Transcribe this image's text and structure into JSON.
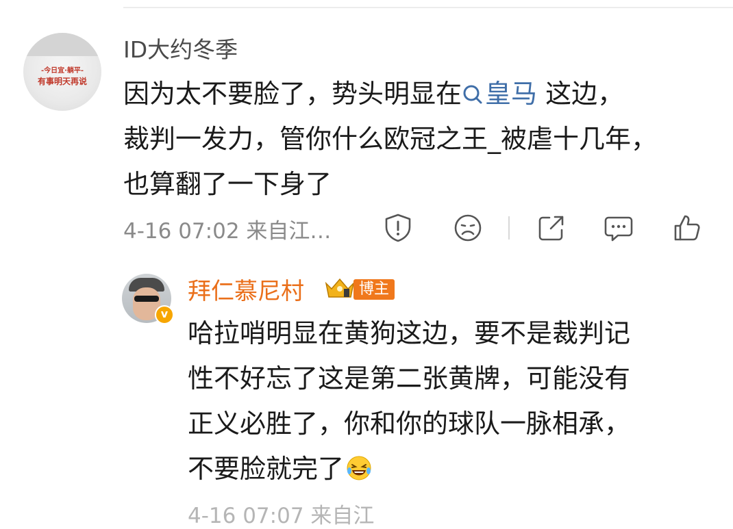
{
  "comment": {
    "avatar_text_line1": "-今日宜·躺平-",
    "avatar_text_line2": "有事明天再说",
    "username": "ID大约冬季",
    "text_line1_before": "因为太不要脸了，势头明显在",
    "topic_icon": "search-icon",
    "topic_label": "皇马",
    "text_line1_after": " 这边，",
    "text_line2": "裁判一发力，管你什么欧冠之王_被虐十几年，",
    "text_line3": "也算翻了一下身了",
    "timestamp": "4-16 07:02",
    "source": "来自江…",
    "actions": [
      {
        "name": "report-icon"
      },
      {
        "name": "dislike-face-icon"
      },
      {
        "name": "share-icon"
      },
      {
        "name": "comment-icon"
      },
      {
        "name": "like-icon"
      }
    ]
  },
  "reply": {
    "username": "拜仁慕尼村",
    "verified_icon": "verified-v-icon",
    "rank_icon": "crown-icon",
    "badge": "博主",
    "lines": [
      "哈拉哨明显在黄狗这边，要不是裁判记",
      "性不好忘了这是第二张黄牌，可能没有",
      "正义必胜了，你和你的球队一脉相承，",
      "不要脸就完了"
    ],
    "emoji": "laughing-crying-emoji",
    "meta_cut": "4-16 07:07 来自江"
  },
  "colors": {
    "link": "#3f6ea8",
    "highlight_username": "#ea6f1a",
    "badge_bg": "#f0781c",
    "meta": "#8a8a8a"
  }
}
